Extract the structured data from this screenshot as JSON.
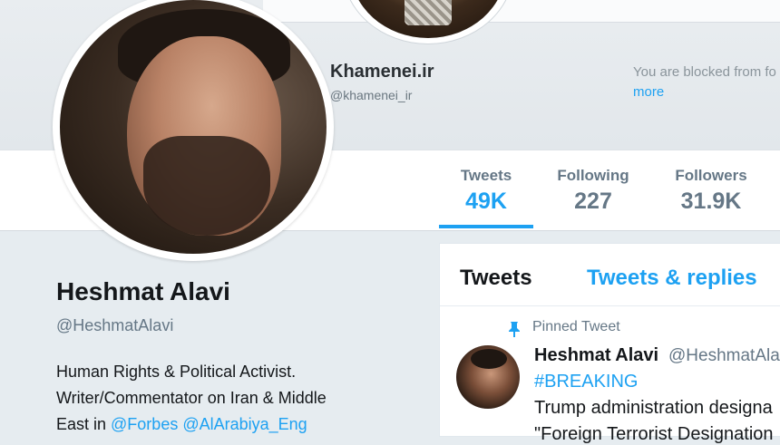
{
  "background_profile": {
    "name": "Khamenei.ir",
    "handle": "@khamenei_ir",
    "blocked_notice": "You are blocked from fo",
    "more_link": "more"
  },
  "stats": {
    "tweets": {
      "label": "Tweets",
      "value": "49K"
    },
    "following": {
      "label": "Following",
      "value": "227"
    },
    "followers": {
      "label": "Followers",
      "value": "31.9K"
    }
  },
  "profile": {
    "name": "Heshmat Alavi",
    "handle": "@HeshmatAlavi",
    "bio_line1": "Human Rights & Political Activist.",
    "bio_line2": "Writer/Commentator on Iran & Middle",
    "bio_line3_prefix": "East in ",
    "mention_forbes": "@Forbes",
    "mention_alarabiya": "@AlArabiya_Eng"
  },
  "timeline": {
    "tab_tweets": "Tweets",
    "tab_replies": "Tweets & replies",
    "pinned_label": "Pinned Tweet",
    "tweet": {
      "author": "Heshmat Alavi",
      "handle": "@HeshmatAla",
      "hashtag": "#BREAKING",
      "line1": "Trump administration designa",
      "line2": "\"Foreign Terrorist Designation"
    }
  },
  "colors": {
    "accent": "#1da1f2",
    "page_bg": "#e6ecf0",
    "muted_text": "#657786"
  }
}
